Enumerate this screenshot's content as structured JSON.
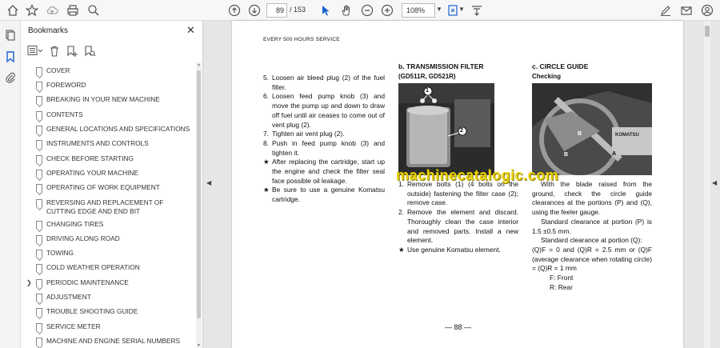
{
  "toolbar": {
    "page_current": "89",
    "page_total": "/ 153",
    "zoom": "108%"
  },
  "bookmarks": {
    "title": "Bookmarks",
    "items": [
      {
        "label": "COVER"
      },
      {
        "label": "FOREWORD"
      },
      {
        "label": "BREAKING IN YOUR NEW MACHINE"
      },
      {
        "label": "CONTENTS"
      },
      {
        "label": "GENERAL LOCATIONS AND SPECIFICATIONS"
      },
      {
        "label": "INSTRUMENTS AND CONTROLS"
      },
      {
        "label": "CHECK BEFORE STARTING"
      },
      {
        "label": "OPERATING YOUR MACHINE"
      },
      {
        "label": "OPERATING OF WORK EQUIPMENT"
      },
      {
        "label": "REVERSING AND REPLACEMENT OF CUTTING EDGE AND END BIT"
      },
      {
        "label": "CHANGING TIRES"
      },
      {
        "label": "DRIVING ALONG ROAD"
      },
      {
        "label": "TOWING"
      },
      {
        "label": "COLD WEATHER OPERATION"
      },
      {
        "label": "PERIODIC MAINTENANCE"
      },
      {
        "label": "ADJUSTMENT"
      },
      {
        "label": "TROUBLE SHOOTING GUIDE"
      },
      {
        "label": "SERVICE METER"
      },
      {
        "label": "MACHINE AND ENGINE SERIAL NUMBERS"
      }
    ]
  },
  "document": {
    "header": "EVERY 500 HOURS SERVICE",
    "col1": {
      "steps": [
        {
          "n": "5.",
          "text": "Loosen air bleed plug (2) of the fuel filter."
        },
        {
          "n": "6.",
          "text": "Loosen feed pump knob (3) and move the pump up and down to draw off fuel until air ceases to come out of vent plug (2)."
        },
        {
          "n": "7.",
          "text": "Tighten air vent plug (2)."
        },
        {
          "n": "8.",
          "text": "Push in feed pump knob (3) and tighten it."
        },
        {
          "n": "★",
          "text": "After replacing the cartridge, start up the engine and check the filter seal face possible oil leakage."
        },
        {
          "n": "★",
          "text": "Be sure to use a genuine Komatsu cartridge."
        }
      ]
    },
    "col2": {
      "heading": "b. TRANSMISSION FILTER",
      "subheading": "(GD511R, GD521R)",
      "photo_labels": [
        "1",
        "2"
      ],
      "steps": [
        {
          "n": "1.",
          "text": "Remove bolts (1) (4 bolts on the outside) fastening the filter case (2); remove case."
        },
        {
          "n": "2.",
          "text": "Remove the element and discard. Thoroughly clean the case interior and removed parts. Install a new element."
        },
        {
          "n": "★",
          "text": "Use genuine Komatsu element."
        }
      ]
    },
    "col3": {
      "heading": "c. CIRCLE GUIDE",
      "subheading": "Checking",
      "photo_labels": [
        "B",
        "A",
        "B",
        "KOMATSU"
      ],
      "p1": "With the blade raised from the ground, check the circle guide clearances at the portions (P) and (Q), using the feeler gauge.",
      "p2": "Standard clearance at portion (P) is 1.5 ±0.5 mm.",
      "p3": "Standard clearance at portion (Q):",
      "p4": "(Q)F = 0 and (Q)R = 2.5 mm or (Q)F (average clearance when rotating circle) = (Q)R = 1 mm",
      "legend_f": "F:  Front",
      "legend_r": "R:  Rear"
    },
    "page_number": "— 88 —",
    "watermark": "machinecatalogic.com"
  }
}
